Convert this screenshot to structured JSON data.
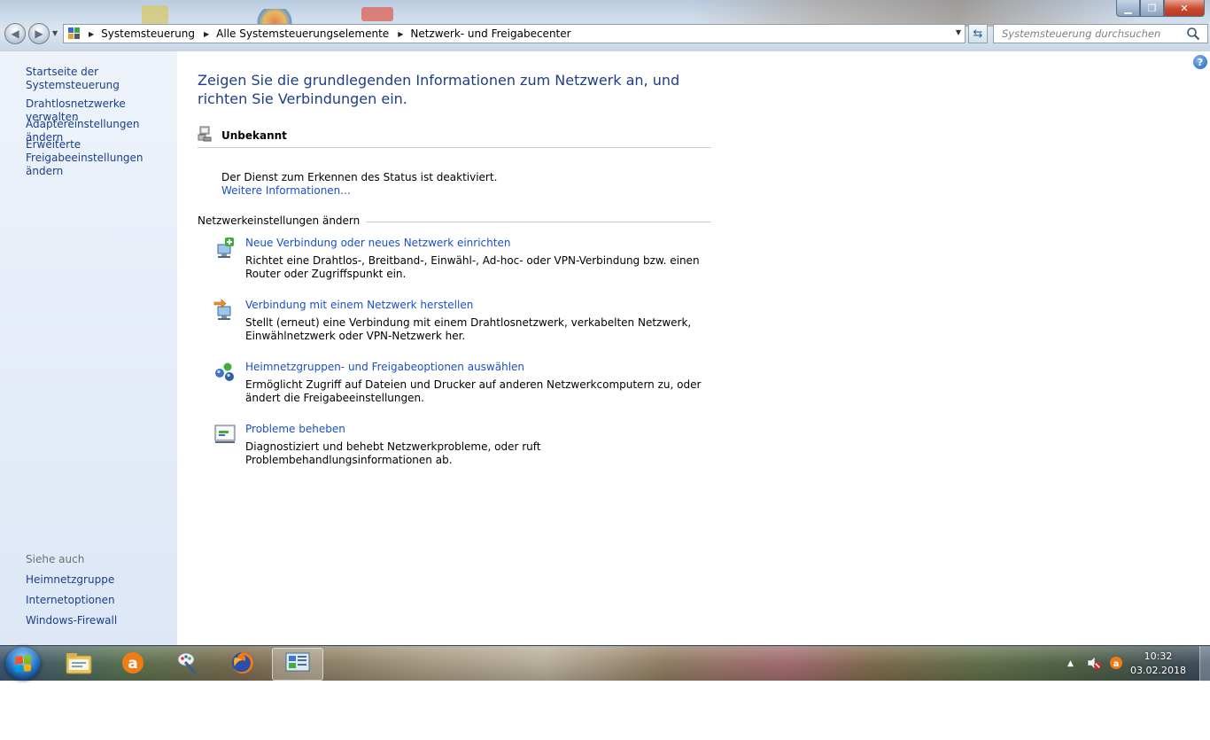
{
  "window": {
    "controls": {
      "minimize": "▁",
      "maximize": "❐",
      "close": "✕"
    }
  },
  "nav": {
    "back_glyph": "◀",
    "forward_glyph": "▶",
    "breadcrumbs": [
      {
        "label": "Systemsteuerung"
      },
      {
        "label": "Alle Systemsteuerungselemente"
      },
      {
        "label": "Netzwerk- und Freigabecenter"
      }
    ],
    "search_placeholder": "Systemsteuerung durchsuchen"
  },
  "sidebar": {
    "home_link": "Startseite der Systemsteuerung",
    "links": [
      "Drahtlosnetzwerke verwalten",
      "Adaptereinstellungen ändern",
      "Erweiterte Freigabeeinstellungen ändern"
    ],
    "see_also_label": "Siehe auch",
    "see_also": [
      "Heimnetzgruppe",
      "Internetoptionen",
      "Windows-Firewall"
    ]
  },
  "main": {
    "title": "Zeigen Sie die grundlegenden Informationen zum Netzwerk an, und richten Sie Verbindungen ein.",
    "network_status": "Unbekannt",
    "status_message": "Der Dienst zum Erkennen des Status ist deaktiviert.",
    "more_info_link": "Weitere Informationen...",
    "section_heading": "Netzwerkeinstellungen ändern",
    "tasks": [
      {
        "link": "Neue Verbindung oder neues Netzwerk einrichten",
        "description": "Richtet eine Drahtlos-, Breitband-, Einwähl-, Ad-hoc- oder VPN-Verbindung bzw. einen Router oder Zugriffspunkt ein.",
        "icon": "new-connection-icon"
      },
      {
        "link": "Verbindung mit einem Netzwerk herstellen",
        "description": "Stellt (erneut) eine Verbindung mit einem Drahtlosnetzwerk, verkabelten Netzwerk, Einwählnetzwerk oder VPN-Netzwerk her.",
        "icon": "connect-network-icon"
      },
      {
        "link": "Heimnetzgruppen- und Freigabeoptionen auswählen",
        "description": "Ermöglicht Zugriff auf Dateien und Drucker auf anderen Netzwerkcomputern zu, oder ändert die Freigabeeinstellungen.",
        "icon": "homegroup-icon"
      },
      {
        "link": "Probleme beheben",
        "description": "Diagnostiziert und behebt Netzwerkprobleme, oder ruft Problembehandlungsinformationen ab.",
        "icon": "troubleshoot-icon"
      }
    ]
  },
  "taskbar": {
    "items": [
      "explorer-icon",
      "avast-icon",
      "paint-tool-icon",
      "firefox-icon",
      "control-panel-icon"
    ],
    "tray_chevron": "▲",
    "time": "10:32",
    "date": "03.02.2018"
  },
  "colors": {
    "link": "#1a4fc8",
    "title": "#1e3d8a",
    "sidebar_link": "#1a3f8a"
  }
}
